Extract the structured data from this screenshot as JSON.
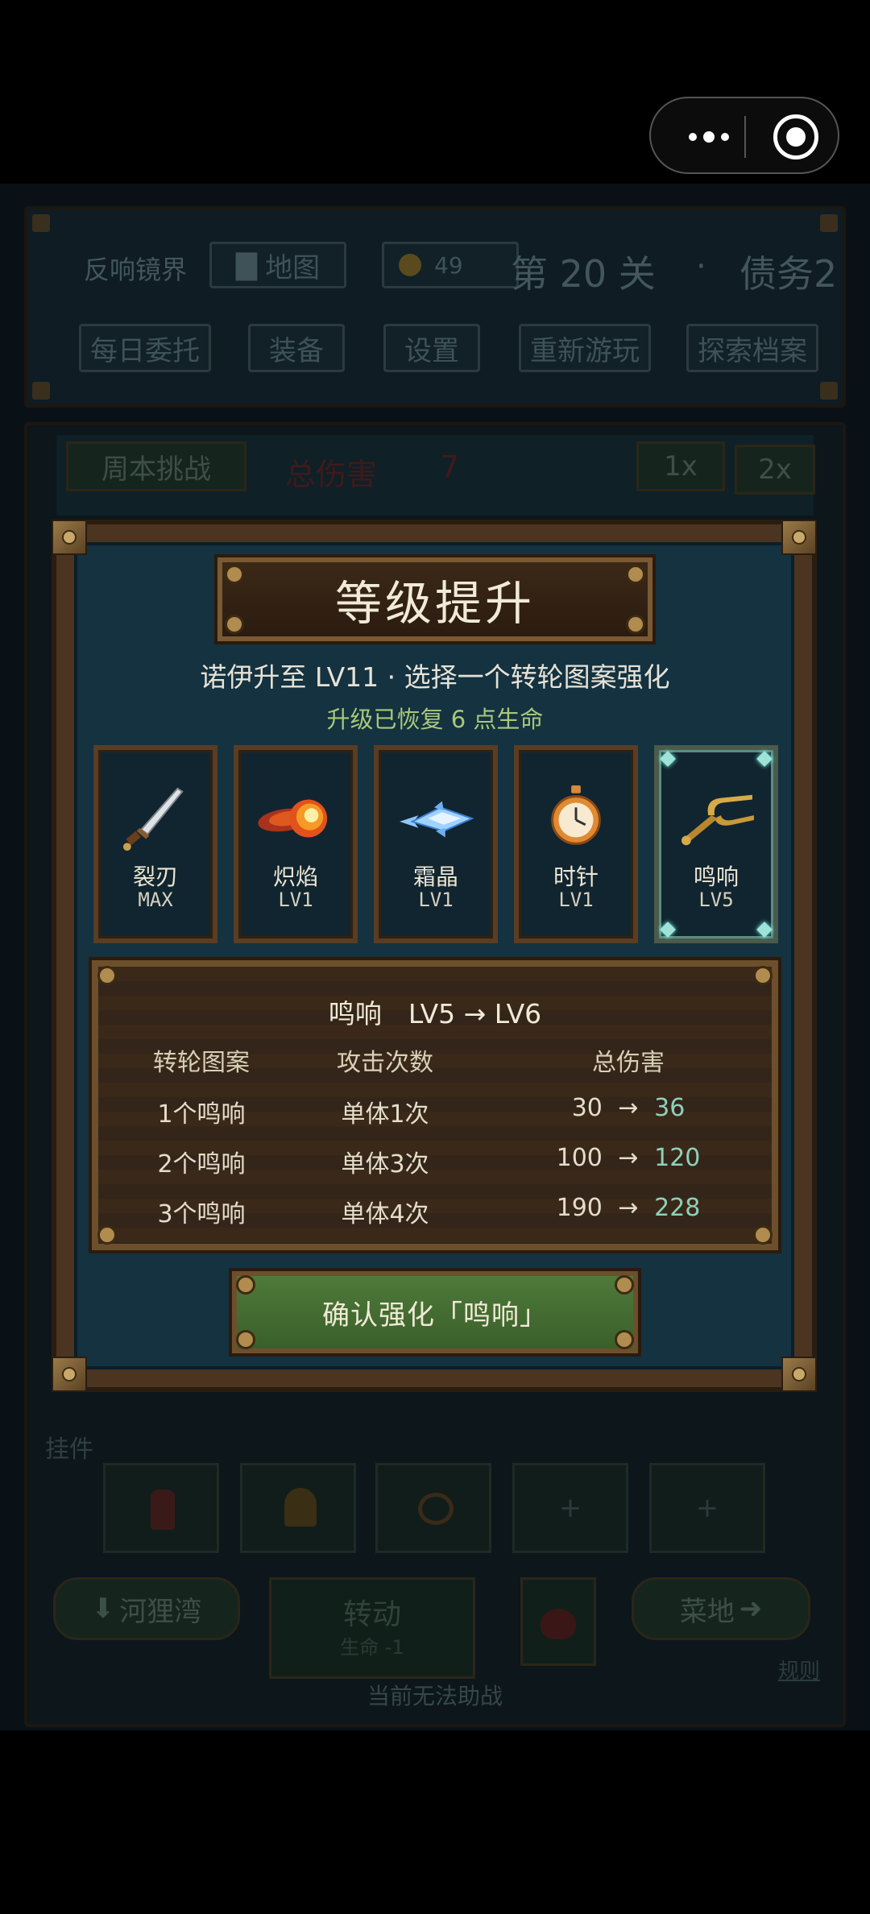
{
  "capsule": {
    "menu_icon": "more-dots-icon",
    "close_icon": "target-icon"
  },
  "background": {
    "top_panel": {
      "realm": "反响镜界",
      "map_button": "地图",
      "coins": "49",
      "stage": "第 20 关",
      "dot": "·",
      "debt": "债务2",
      "buttons": [
        "每日委托",
        "装备",
        "设置",
        "重新游玩",
        "探索档案"
      ]
    },
    "battle_bar": {
      "weekly_challenge": "周本挑战",
      "total_damage_label": "总伤害",
      "total_damage_value": "7",
      "speed_1x": "1x",
      "speed_2x": "2x"
    },
    "charms": {
      "label": "挂件",
      "slots": [
        "",
        "",
        "",
        "+",
        "+"
      ]
    },
    "bottom": {
      "left_button": "河狸湾",
      "spin_label": "转动",
      "spin_cost": "生命 -1",
      "right_button": "菜地",
      "rules_link": "规则",
      "assist_status": "当前无法助战"
    }
  },
  "modal": {
    "title": "等级提升",
    "subtitle": "诺伊升至 LV11 · 选择一个转轮图案强化",
    "recover": "升级已恢复 6 点生命",
    "cards": [
      {
        "name": "裂刃",
        "level": "MAX",
        "icon": "blade-icon"
      },
      {
        "name": "炽焰",
        "level": "LV1",
        "icon": "fireball-icon"
      },
      {
        "name": "霜晶",
        "level": "LV1",
        "icon": "ice-crystal-icon"
      },
      {
        "name": "时针",
        "level": "LV1",
        "icon": "pocket-watch-icon"
      },
      {
        "name": "鸣响",
        "level": "LV5",
        "icon": "tuning-fork-icon"
      }
    ],
    "info": {
      "header": "鸣响　LV5 → LV6",
      "columns": [
        "转轮图案",
        "攻击次数",
        "总伤害"
      ],
      "rows": [
        {
          "pattern": "1个鸣响",
          "attacks": "单体1次",
          "old": "30",
          "arrow": "→",
          "new": "36"
        },
        {
          "pattern": "2个鸣响",
          "attacks": "单体3次",
          "old": "100",
          "arrow": "→",
          "new": "120"
        },
        {
          "pattern": "3个鸣响",
          "attacks": "单体4次",
          "old": "190",
          "arrow": "→",
          "new": "228"
        }
      ]
    },
    "confirm": "确认强化「鸣响」"
  }
}
